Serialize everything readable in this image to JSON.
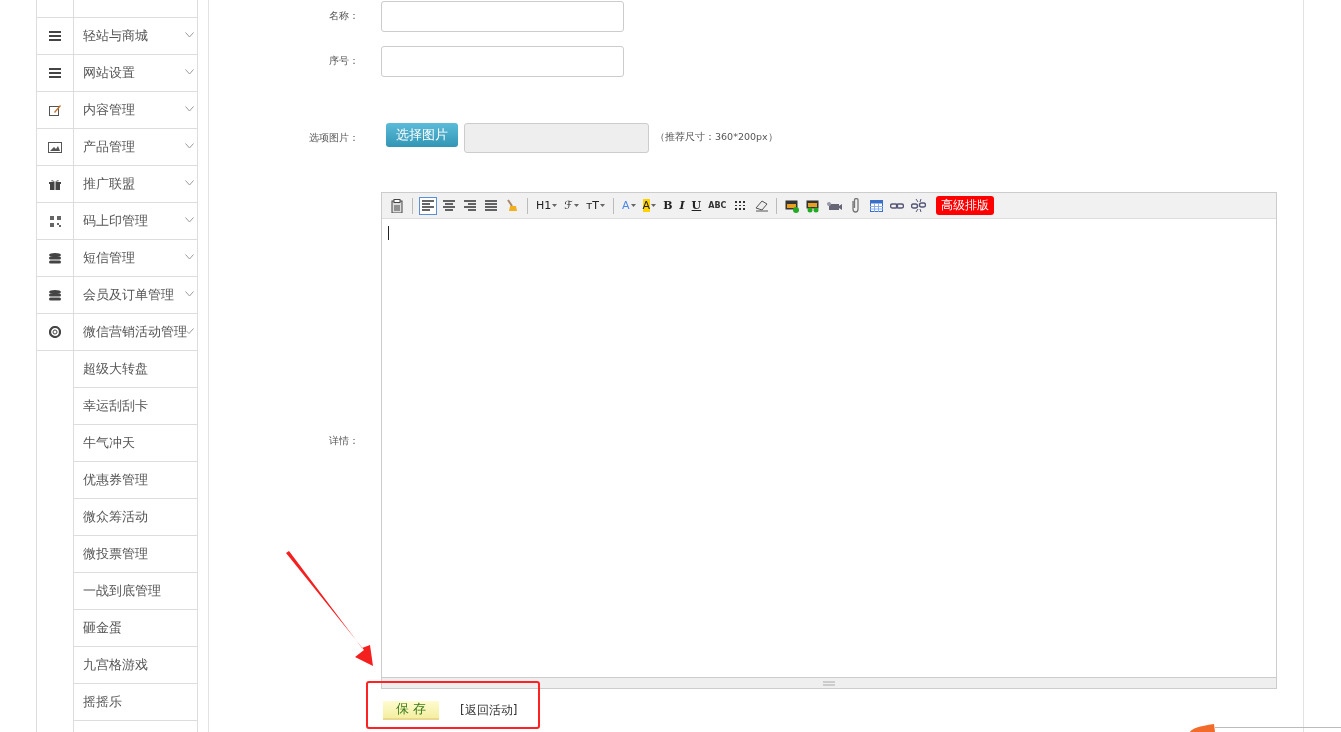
{
  "sidebar": {
    "items": [
      {
        "label": "轻站与商城",
        "expanded": false
      },
      {
        "label": "网站设置",
        "expanded": false
      },
      {
        "label": "内容管理",
        "expanded": false
      },
      {
        "label": "产品管理",
        "expanded": false
      },
      {
        "label": "推广联盟",
        "expanded": false
      },
      {
        "label": "码上印管理",
        "expanded": false
      },
      {
        "label": "短信管理",
        "expanded": false
      },
      {
        "label": "会员及订单管理",
        "expanded": false
      },
      {
        "label": "微信营销活动管理",
        "expanded": true,
        "children": [
          {
            "label": "超级大转盘"
          },
          {
            "label": "幸运刮刮卡"
          },
          {
            "label": "牛气冲天"
          },
          {
            "label": "优惠券管理"
          },
          {
            "label": "微众筹活动"
          },
          {
            "label": "微投票管理"
          },
          {
            "label": "一战到底管理"
          },
          {
            "label": "砸金蛋"
          },
          {
            "label": "九宫格游戏"
          },
          {
            "label": "摇摇乐"
          }
        ]
      }
    ]
  },
  "form": {
    "name_label": "名称：",
    "order_label": "序号：",
    "image_label": "选项图片：",
    "choose_image_button": "选择图片",
    "image_hint": "（推荐尺寸：360*200px）",
    "detail_label": "详情："
  },
  "editor": {
    "toolbar": [
      {
        "kind": "icon",
        "selected": false
      },
      {
        "kind": "separator"
      },
      {
        "kind": "icon",
        "selected": true
      },
      {
        "kind": "icon",
        "selected": false
      },
      {
        "kind": "icon",
        "selected": false
      },
      {
        "kind": "icon",
        "selected": false
      },
      {
        "kind": "icon",
        "selected": false
      },
      {
        "kind": "separator"
      },
      {
        "kind": "text",
        "label": "H1",
        "dropdown": true
      },
      {
        "kind": "text",
        "label": "ℱ",
        "dropdown": true
      },
      {
        "kind": "text",
        "label": "ᴛT",
        "dropdown": true
      },
      {
        "kind": "separator"
      },
      {
        "kind": "text",
        "label": "A",
        "dropdown": true,
        "color": "#4a86e8"
      },
      {
        "kind": "highlight",
        "label": "A",
        "dropdown": true,
        "color": "#ffd200"
      },
      {
        "kind": "bold",
        "label": "B"
      },
      {
        "kind": "italic",
        "label": "I"
      },
      {
        "kind": "underline",
        "label": "U"
      },
      {
        "kind": "strike",
        "label": "ABC"
      },
      {
        "kind": "icon",
        "selected": false
      },
      {
        "kind": "icon",
        "selected": false
      },
      {
        "kind": "separator"
      },
      {
        "kind": "icon",
        "selected": false
      },
      {
        "kind": "icon",
        "selected": false
      },
      {
        "kind": "icon",
        "selected": false
      },
      {
        "kind": "icon",
        "selected": false
      },
      {
        "kind": "icon",
        "selected": false
      },
      {
        "kind": "icon",
        "selected": false
      },
      {
        "kind": "icon",
        "selected": false
      },
      {
        "kind": "badge",
        "label": "高级排版"
      }
    ]
  },
  "actions": {
    "save_button": "保 存",
    "back_link": "[返回活动]"
  }
}
